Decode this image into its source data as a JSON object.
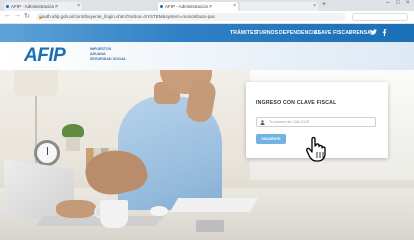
{
  "browser": {
    "tabs": [
      {
        "label": "AFIP - Administración F",
        "active": false
      },
      {
        "label": "AFIP - Administración F",
        "active": true
      },
      {
        "label": "",
        "active": false
      }
    ],
    "url": "auth.afip.gob.ar/contribuyente_/login.xhtml?action=SYSTEM&system=monotributo-pas",
    "new_tab_symbol": "+",
    "back_symbol": "←",
    "forward_symbol": "→",
    "reload_symbol": "↻"
  },
  "topnav": {
    "items": [
      "TRÁMITES",
      "TURNOS",
      "DEPENDENCIAS",
      "CLAVE FISCAL",
      "PRENSA"
    ],
    "social": [
      "twitter-icon",
      "facebook-icon"
    ]
  },
  "header": {
    "logo_text": "AFIP",
    "logo_subtitle": [
      "IMPUESTOS",
      "ADUANA",
      "SEGURIDAD SOCIAL"
    ]
  },
  "login": {
    "title": "INGRESO CON CLAVE FISCAL",
    "input_placeholder": "Tu número de CUIL/CUIT",
    "button_label": "SIGUIENTE"
  },
  "colors": {
    "brand_blue": "#1b6fb5",
    "nav_gradient_start": "#5fa3d8",
    "button_blue": "#6fb3e3"
  }
}
